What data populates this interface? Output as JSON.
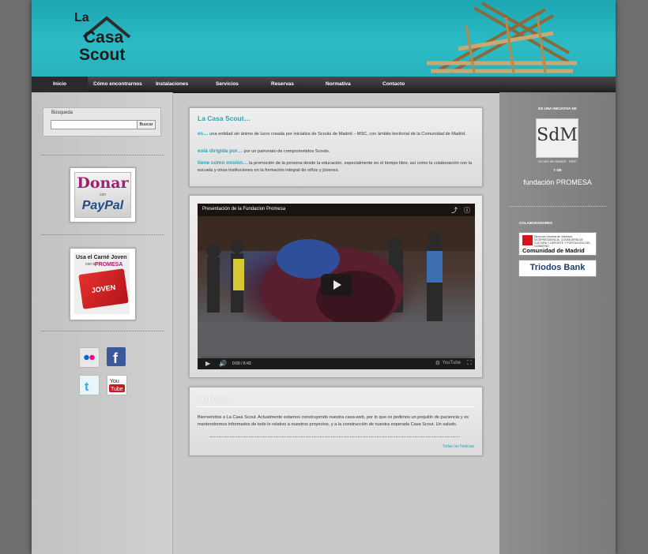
{
  "header": {
    "logo": {
      "line1": "La",
      "line2": "Casa",
      "line3": "Scout"
    }
  },
  "nav": {
    "items": [
      {
        "label": "Inicio"
      },
      {
        "label": "Cómo encontrarnos"
      },
      {
        "label": "Instalaciones"
      },
      {
        "label": "Servicios"
      },
      {
        "label": "Reservas"
      },
      {
        "label": "Normativa"
      },
      {
        "label": "Contacto"
      }
    ]
  },
  "left": {
    "search": {
      "label": "Búsqueda",
      "button": "Buscar",
      "value": ""
    },
    "donate": {
      "line1": "Donar",
      "line2": "con",
      "line3": "PayPal"
    },
    "carne": {
      "line1": "Usa el Carné Joven",
      "line2": "con la",
      "line3": "PROMESA",
      "card": "JOVEN"
    },
    "social": [
      {
        "icon": "flickr-icon",
        "color": "#ff0084"
      },
      {
        "icon": "facebook-icon",
        "color": "#3b5998"
      },
      {
        "icon": "twitter-icon",
        "color": "#33ccff"
      },
      {
        "icon": "youtube-icon",
        "color": "#cc181e"
      }
    ]
  },
  "intro": {
    "title": "La Casa Scout…",
    "p1_lead": "es…",
    "p1_text": " una entidad sin ánimo de lucro creada por iniciativa de Scouts de Madrid – MSC, con ámbito territorial de la Comunidad de Madrid.",
    "p2_lead": "está dirigida por…",
    "p2_text": " por un patronato de comprometidos Scouts.",
    "p3_lead": "tiene como misión…",
    "p3_text": " la promoción de la persona desde la educación, especialmente en el tiempo libre, así como la colaboración con la escuela y otras instituciones en la formación integral de niños y jóvenes."
  },
  "video": {
    "title": "Presentación de la Fundacion Promesa",
    "time": "0:00 / 6:43"
  },
  "news": {
    "title": "NOTICIAS",
    "body": "Bienvenidos a La Casa Scout. Actualmente estamos construyendo nuestra casa-web, por lo que os pedimos un poquitín de paciencia y os mantendremos informados de todo lo relativo a nuestros proyectos, y a la construcción de nuestra esperada Casa Scout. Un saludo.",
    "link": "Todas las Noticias"
  },
  "right": {
    "initiative": "ES UNA INICIATIVA DE",
    "sdm_logo": "SdM",
    "sdm_caption": "Scouts de Madrid - MSC",
    "y_de": "Y DE",
    "promesa": "fundación PROMESA",
    "colaboradores": "COLABORADORES",
    "madrid_small": "Dirección General de Juventud VICEPRESIDENCIA, CONSEJERÍA DE CULTURA Y DEPORTE Y PORTAVOCÍA DEL GOBIERNO",
    "madrid_big": "Comunidad de Madrid",
    "triodos": "Triodos Bank"
  }
}
